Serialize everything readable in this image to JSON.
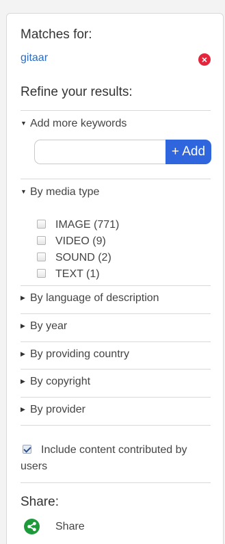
{
  "matches": {
    "title": "Matches for:",
    "term": "gitaar",
    "remove_icon": "close-circle-icon"
  },
  "refine": {
    "title": "Refine your results:",
    "keywords": {
      "label": "Add more keywords",
      "input_value": "",
      "add_button": "+ Add"
    },
    "media_type": {
      "label": "By media type",
      "options": [
        {
          "label": "IMAGE (771)",
          "checked": false
        },
        {
          "label": "VIDEO (9)",
          "checked": false
        },
        {
          "label": "SOUND (2)",
          "checked": false
        },
        {
          "label": "TEXT (1)",
          "checked": false
        }
      ]
    },
    "collapsed_sections": [
      "By language of description",
      "By year",
      "By providing country",
      "By copyright",
      "By provider"
    ],
    "user_content": {
      "label": "Include content contributed by users",
      "checked": true
    }
  },
  "share": {
    "title": "Share:",
    "button_label": "Share",
    "icon": "share-icon"
  },
  "colors": {
    "link": "#2a6bc0",
    "accent_button": "#2f66dd",
    "remove_red": "#e5253c",
    "share_green": "#1f9a3a"
  }
}
